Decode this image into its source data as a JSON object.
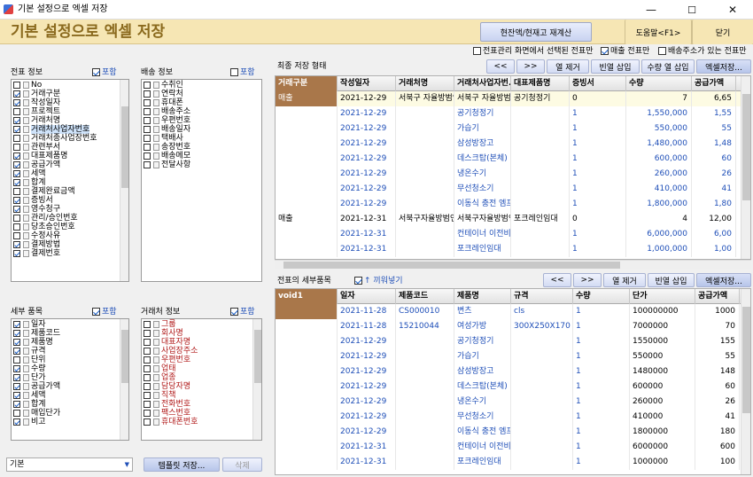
{
  "window": {
    "title": "기본 설정으로 엑셀 저장",
    "min": "—",
    "max": "☐",
    "close": "✕"
  },
  "header": {
    "title": "기본 설정으로 엑셀 저장",
    "recalc": "현잔액/현재고 재계산",
    "help": "도움말<F1>",
    "close": "닫기"
  },
  "options": [
    {
      "label": "전표관리 화면에서 선택된 전표만",
      "checked": false
    },
    {
      "label": "매출 전표만",
      "checked": true
    },
    {
      "label": "배송주소가 있는 전표만",
      "checked": false
    }
  ],
  "voucher_info": {
    "label": "전표 정보",
    "include": "포함",
    "items": [
      {
        "t": "No",
        "c": false
      },
      {
        "t": "거래구분",
        "c": true
      },
      {
        "t": "작성일자",
        "c": true
      },
      {
        "t": "프로젝트",
        "c": false
      },
      {
        "t": "거래처명",
        "c": true
      },
      {
        "t": "거래처사업자번호",
        "c": true,
        "sel": true
      },
      {
        "t": "거래처종사업장번호",
        "c": false
      },
      {
        "t": "관련부서",
        "c": false
      },
      {
        "t": "대표제품명",
        "c": true
      },
      {
        "t": "공급가액",
        "c": true
      },
      {
        "t": "세액",
        "c": true
      },
      {
        "t": "합계",
        "c": true
      },
      {
        "t": "결제완료금액",
        "c": false
      },
      {
        "t": "증빙서",
        "c": true
      },
      {
        "t": "영수청구",
        "c": true
      },
      {
        "t": "관리/승인번호",
        "c": false
      },
      {
        "t": "당초승인번호",
        "c": false
      },
      {
        "t": "수정사유",
        "c": false
      },
      {
        "t": "결제방법",
        "c": true
      },
      {
        "t": "결제번호",
        "c": true
      }
    ]
  },
  "shipping_info": {
    "label": "배송 정보",
    "include": "포함",
    "items": [
      {
        "t": "수취인",
        "c": false
      },
      {
        "t": "연락처",
        "c": false
      },
      {
        "t": "휴대폰",
        "c": false
      },
      {
        "t": "배송주소",
        "c": false
      },
      {
        "t": "우편번호",
        "c": false
      },
      {
        "t": "배송일자",
        "c": false
      },
      {
        "t": "택배사",
        "c": false
      },
      {
        "t": "송장번호",
        "c": false
      },
      {
        "t": "배송메모",
        "c": false
      },
      {
        "t": "전달사항",
        "c": false
      }
    ]
  },
  "detail_items": {
    "label": "세부 품목",
    "include": "포함",
    "items": [
      {
        "t": "일자",
        "c": true
      },
      {
        "t": "제품코드",
        "c": true
      },
      {
        "t": "제품명",
        "c": true
      },
      {
        "t": "규격",
        "c": true
      },
      {
        "t": "단위",
        "c": false
      },
      {
        "t": "수량",
        "c": true
      },
      {
        "t": "단가",
        "c": true
      },
      {
        "t": "공급가액",
        "c": true
      },
      {
        "t": "세액",
        "c": true
      },
      {
        "t": "합계",
        "c": true
      },
      {
        "t": "매입단가",
        "c": false
      },
      {
        "t": "비고",
        "c": true
      }
    ]
  },
  "partner_info": {
    "label": "거래처 정보",
    "include": "포함",
    "items": [
      {
        "t": "그룹",
        "c": false
      },
      {
        "t": "회사명",
        "c": false
      },
      {
        "t": "대표자명",
        "c": false
      },
      {
        "t": "사업장주소",
        "c": false
      },
      {
        "t": "우편번호",
        "c": false
      },
      {
        "t": "업태",
        "c": false
      },
      {
        "t": "업종",
        "c": false
      },
      {
        "t": "담당자명",
        "c": false
      },
      {
        "t": "직책",
        "c": false
      },
      {
        "t": "전화번호",
        "c": false
      },
      {
        "t": "팩스번호",
        "c": false
      },
      {
        "t": "휴대폰번호",
        "c": false
      }
    ]
  },
  "template": {
    "value": "기본",
    "save": "템플릿 저장...",
    "delete": "삭제"
  },
  "final_form": {
    "label": "최종 저장 형태",
    "prev": "<<",
    "next": ">>",
    "col_delete": "열 제거",
    "blank_insert": "빈열 삽입",
    "qty_insert": "수량 열 삽입",
    "excel_save": "엑셀저장..."
  },
  "main_grid": {
    "columns": [
      "거래구분",
      "작성일자",
      "거래처명",
      "거래처사업자번...",
      "대표제품명",
      "증빙서",
      "수량",
      "공급가액"
    ],
    "rows": [
      [
        "매출",
        "2021-12-29",
        "서북구 자율방범연",
        "서북구 자율방범연",
        "공기청정기",
        "0",
        "7",
        "6,65"
      ],
      [
        "",
        "2021-12-29",
        "",
        "공기청정기",
        "",
        "1",
        "1,550,000",
        "1,55"
      ],
      [
        "",
        "2021-12-29",
        "",
        "가습기",
        "",
        "1",
        "550,000",
        "55"
      ],
      [
        "",
        "2021-12-29",
        "",
        "삼성방장고",
        "",
        "1",
        "1,480,000",
        "1,48"
      ],
      [
        "",
        "2021-12-29",
        "",
        "데스크탑(본체)",
        "",
        "1",
        "600,000",
        "60"
      ],
      [
        "",
        "2021-12-29",
        "",
        "냉온수기",
        "",
        "1",
        "260,000",
        "26"
      ],
      [
        "",
        "2021-12-29",
        "",
        "무선청소기",
        "",
        "1",
        "410,000",
        "41"
      ],
      [
        "",
        "2021-12-29",
        "",
        "이동식 충전 엠프",
        "",
        "1",
        "1,800,000",
        "1,80"
      ],
      [
        "매출",
        "2021-12-31",
        "서북구자율방범연",
        "서북구자율방범연",
        "포크레인임대",
        "0",
        "4",
        "12,00"
      ],
      [
        "",
        "2021-12-31",
        "",
        "컨테이너 이전비",
        "",
        "1",
        "6,000,000",
        "6,00"
      ],
      [
        "",
        "2021-12-31",
        "",
        "포크레인임대",
        "",
        "1",
        "1,000,000",
        "1,00"
      ]
    ]
  },
  "detail_form": {
    "label": "전표의 세부품목",
    "clip": "↑ 끼워넣기",
    "prev": "<<",
    "next": ">>",
    "col_delete": "열 제거",
    "blank_insert": "빈열 삽입",
    "excel_save": "엑셀저장..."
  },
  "detail_grid": {
    "columns": [
      "void1",
      "일자",
      "제품코드",
      "제품명",
      "규격",
      "수량",
      "단가",
      "공급가액"
    ],
    "rows": [
      [
        "",
        "2021-11-28",
        "CS000010",
        "변츠",
        "cls",
        "1",
        "100000000",
        "1000"
      ],
      [
        "",
        "2021-11-28",
        "15210044",
        "여성가방",
        "300X250X170",
        "1",
        "7000000",
        "70"
      ],
      [
        "",
        "2021-12-29",
        "",
        "공기청정기",
        "",
        "1",
        "1550000",
        "155"
      ],
      [
        "",
        "2021-12-29",
        "",
        "가습기",
        "",
        "1",
        "550000",
        "55"
      ],
      [
        "",
        "2021-12-29",
        "",
        "삼성방장고",
        "",
        "1",
        "1480000",
        "148"
      ],
      [
        "",
        "2021-12-29",
        "",
        "데스크탑(본체)",
        "",
        "1",
        "600000",
        "60"
      ],
      [
        "",
        "2021-12-29",
        "",
        "냉온수기",
        "",
        "1",
        "260000",
        "26"
      ],
      [
        "",
        "2021-12-29",
        "",
        "무선청소기",
        "",
        "1",
        "410000",
        "41"
      ],
      [
        "",
        "2021-12-29",
        "",
        "이동식 충전 엠프",
        "",
        "1",
        "1800000",
        "180"
      ],
      [
        "",
        "2021-12-31",
        "",
        "컨테이너 이전비",
        "",
        "1",
        "6000000",
        "600"
      ],
      [
        "",
        "2021-12-31",
        "",
        "포크레인임대",
        "",
        "1",
        "1000000",
        "100"
      ]
    ]
  }
}
